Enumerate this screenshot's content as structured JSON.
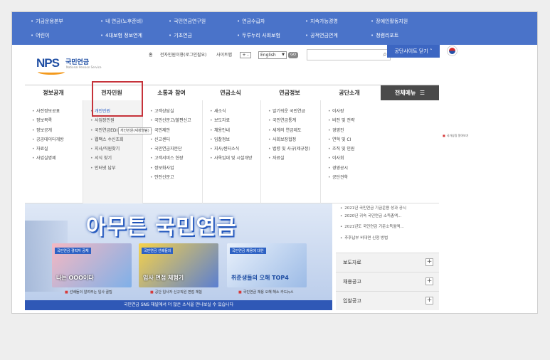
{
  "topbar": {
    "items": [
      {
        "label": "기금운용본부"
      },
      {
        "label": "내 연금(노후준비)"
      },
      {
        "label": "국민연금연구원"
      },
      {
        "label": "연금수급자"
      },
      {
        "label": "지속가능경영"
      },
      {
        "label": "장애인활동지원"
      },
      {
        "label": "어린이"
      },
      {
        "label": "4대보험 정보연계"
      },
      {
        "label": "기초연금"
      },
      {
        "label": "두루누리 사회보험"
      },
      {
        "label": "공적연금연계"
      },
      {
        "label": "청렴리포트"
      }
    ]
  },
  "header": {
    "logo_mark": "NPS",
    "logo_kr": "국민연금",
    "logo_en": "National Pension Service",
    "util_home": "홈",
    "util_login": "전자민원이용(로그인필요)",
    "util_sitemap": "사이트맵",
    "zoom": "+ -",
    "language": "English",
    "go": "GO",
    "site_button": "공단사이트 닫기 ˄",
    "flag_caption": "국가상징 알아보기"
  },
  "gnb": {
    "tabs": [
      {
        "label": "정보공개"
      },
      {
        "label": "전자민원"
      },
      {
        "label": "소통과 참여"
      },
      {
        "label": "연금소식"
      },
      {
        "label": "연금정보"
      },
      {
        "label": "공단소개"
      }
    ],
    "all_menu": "전체메뉴"
  },
  "menu": {
    "columns": [
      {
        "items": [
          "사전정보공표",
          "정보목록",
          "정보공개",
          "공공데이터개방",
          "자료실",
          "사업실명제"
        ]
      },
      {
        "items": [
          "개인민원",
          "사업장민원",
          "국민연금EDI",
          "웹팩스 수신조회",
          "지사/직원찾기",
          "서식 찾기",
          "인터넷 납부"
        ]
      },
      {
        "items": [
          "고객상담실",
          "국민신문고/불편신고",
          "국민제안",
          "신고센터",
          "국민연금자문단",
          "고객서비스 헌장",
          "정보화사업",
          "안전신문고"
        ]
      },
      {
        "items": [
          "새소식",
          "보도자료",
          "채용안내",
          "입찰정보",
          "지사/센터소식",
          "사옥임대 및 시설개방"
        ]
      },
      {
        "items": [
          "알기쉬운 국민연금",
          "국민연금통계",
          "세계의 연금제도",
          "사회보장협정",
          "법령 및 사규(제규정)",
          "자료실"
        ]
      },
      {
        "items": [
          "이사장",
          "비전 및 전략",
          "경영진",
          "연혁 및 CI",
          "조직 및 인원",
          "이사회",
          "경영공시",
          "공단견학"
        ]
      }
    ],
    "tooltip": "개인민원(새창열림)"
  },
  "banner": {
    "hero": "아무튼 국민연금",
    "cards": [
      {
        "tag": "국민연금 경력자 공채",
        "text": "나는 OOO이다",
        "caption": "선배들의 알려주는 입사 꿀팁"
      },
      {
        "tag": "국민연금 선배들의",
        "text": "입사 면접 체험기",
        "caption": "공단 입사자 신규직원 면접 체험"
      },
      {
        "tag": "국민연금 채용에 대한",
        "text": "취준생들의 오해 TOP4",
        "caption": "국민연금 채용 오해 해소 카드뉴스"
      }
    ],
    "footer": "국민연금 SNS 채널에서 더 많은 소식을 만나보실 수 있습니다"
  },
  "side": {
    "news": [
      "2021년 국민연금 기금운용 성과 공시",
      "2020년 귀속 국민연금 소득총액...",
      "2021년도 국민연금 기준소득월액...",
      "추후납부 비대면 신청 방법"
    ],
    "panels": [
      {
        "label": "보도자료"
      },
      {
        "label": "채용공고"
      },
      {
        "label": "입찰공고"
      }
    ]
  }
}
